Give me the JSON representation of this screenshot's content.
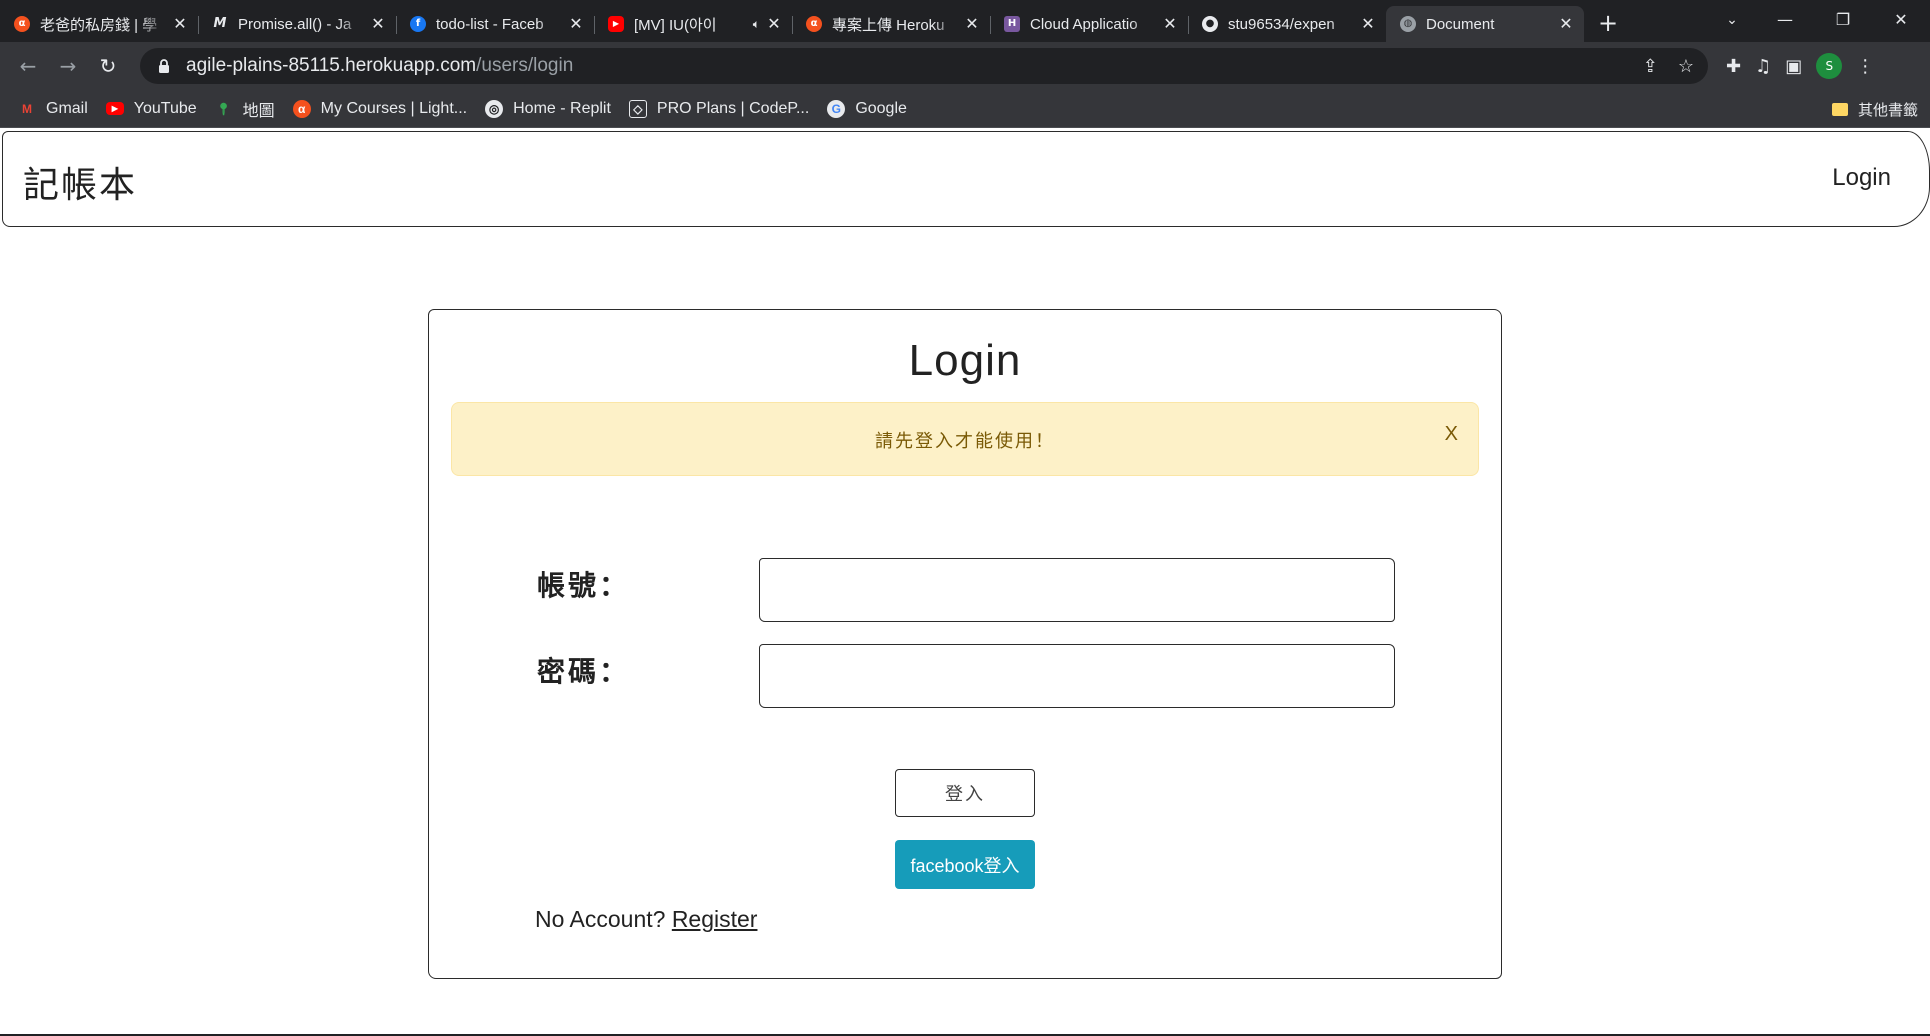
{
  "browser": {
    "tabs": [
      {
        "title": "老爸的私房錢 | 學",
        "icon": "alpha-camp-icon",
        "color": "#f4511e"
      },
      {
        "title": "Promise.all() - Ja",
        "icon": "mdn-icon",
        "color": "#202124"
      },
      {
        "title": "todo-list - Faceb",
        "icon": "facebook-icon",
        "color": "#1877f2"
      },
      {
        "title": "[MV] IU(아이",
        "icon": "youtube-icon",
        "color": "#ff0000"
      },
      {
        "title": "專案上傳 Heroku",
        "icon": "alpha-camp-icon",
        "color": "#f4511e"
      },
      {
        "title": "Cloud Applicatio",
        "icon": "heroku-icon",
        "color": "#79589f"
      },
      {
        "title": "stu96534/expen",
        "icon": "github-icon",
        "color": "#e8eaed"
      },
      {
        "title": "Document",
        "icon": "globe-icon",
        "color": "#9aa0a6"
      }
    ],
    "active_tab": 7,
    "url_host": "agile-plains-85115.herokuapp.com",
    "url_path": "/users/login",
    "profile_initial": "S",
    "bookmarks": [
      {
        "label": "Gmail",
        "icon": "gmail-icon"
      },
      {
        "label": "YouTube",
        "icon": "youtube-icon"
      },
      {
        "label": "地圖",
        "icon": "maps-icon"
      },
      {
        "label": "My Courses | Light...",
        "icon": "alpha-camp-icon"
      },
      {
        "label": "Home - Replit",
        "icon": "replit-icon"
      },
      {
        "label": "PRO Plans | CodeP...",
        "icon": "codepen-icon"
      },
      {
        "label": "Google",
        "icon": "google-icon"
      }
    ],
    "other_bookmarks": "其他書籤"
  },
  "app": {
    "brand": "記帳本",
    "nav_login": "Login"
  },
  "login": {
    "title": "Login",
    "alert_message": "請先登入才能使用！",
    "alert_close": "X",
    "username_label": "帳號：",
    "password_label": "密碼：",
    "username_value": "",
    "password_value": "",
    "submit_label": "登入",
    "facebook_label": "facebook登入",
    "no_account_text": "No Account?",
    "register_label": "Register"
  }
}
